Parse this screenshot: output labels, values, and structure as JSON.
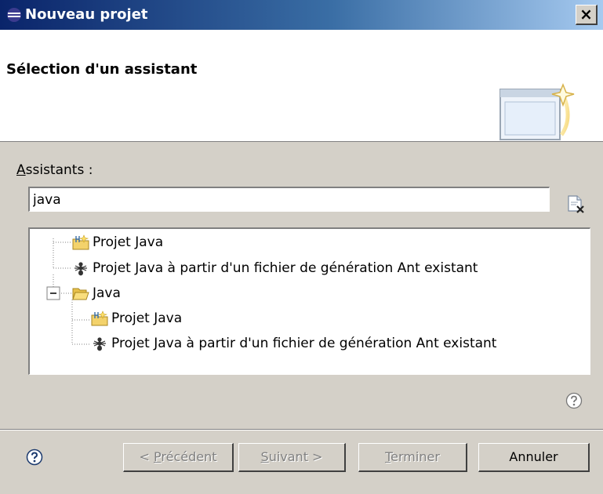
{
  "window": {
    "title": "Nouveau projet",
    "close_label": "×"
  },
  "header": {
    "heading": "Sélection d'un assistant"
  },
  "wizards": {
    "label_mnemonic": "A",
    "label_rest": "ssistants :",
    "filter_value": "java"
  },
  "tree": {
    "items": [
      {
        "label": "Projet Java",
        "icon": "java-project-icon"
      },
      {
        "label": "Projet Java à partir d'un fichier de génération Ant existant",
        "icon": "ant-icon"
      },
      {
        "label": "Java",
        "icon": "folder-open-icon",
        "expanded": true
      },
      {
        "label": "Projet Java",
        "icon": "java-project-icon"
      },
      {
        "label": "Projet Java à partir d'un fichier de génération Ant existant",
        "icon": "ant-icon"
      }
    ]
  },
  "buttons": {
    "previous_prefix": "< ",
    "previous_mnemonic": "P",
    "previous_rest": "récédent",
    "next_mnemonic": "S",
    "next_rest": "uivant >",
    "finish_mnemonic": "T",
    "finish_rest": "erminer",
    "cancel": "Annuler"
  },
  "colors": {
    "titlebar_start": "#0a246a",
    "titlebar_end": "#a6caf0",
    "dialog_bg": "#d4d0c8",
    "disabled_text": "#808080"
  }
}
